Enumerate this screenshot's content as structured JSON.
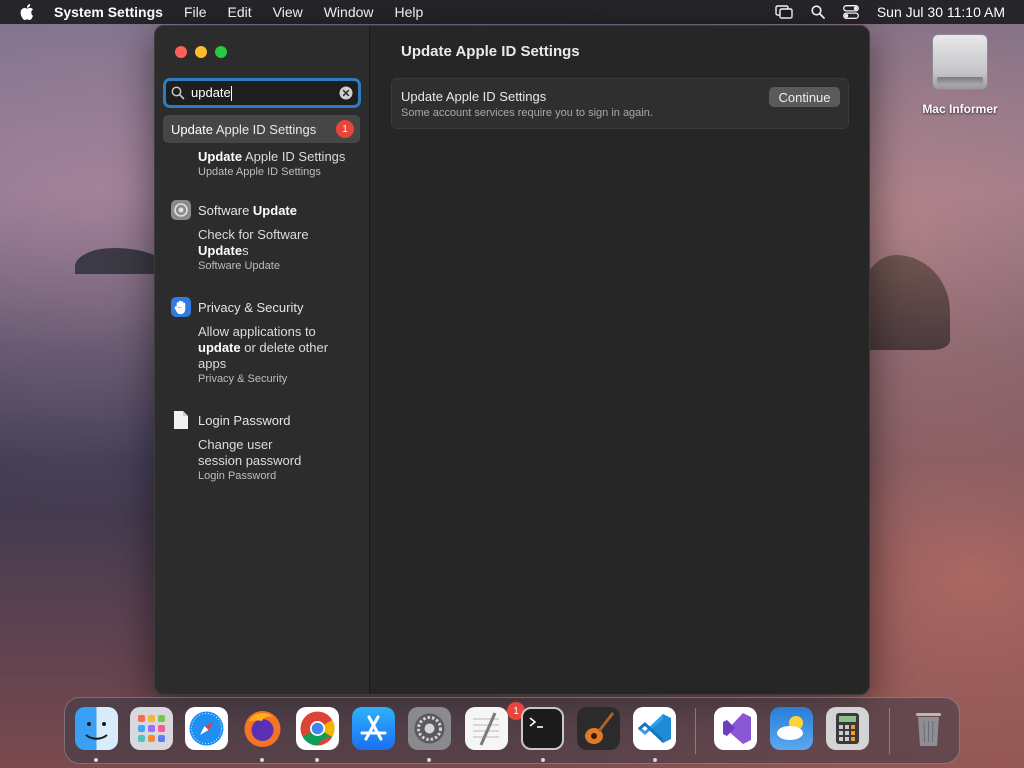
{
  "menubar": {
    "app_name": "System Settings",
    "items": [
      "File",
      "Edit",
      "View",
      "Window",
      "Help"
    ],
    "clock": "Sun Jul 30  11:10 AM"
  },
  "desktop": {
    "drive_label": "Mac Informer"
  },
  "window": {
    "search": {
      "value": "update",
      "placeholder": "Search"
    },
    "top_result": {
      "highlight": "Update",
      "rest": " Apple ID Settings",
      "badge": "1"
    },
    "groups": [
      {
        "icon": "apple-id-icon",
        "sub": {
          "bold": "Update",
          "rest": " Apple ID Settings",
          "category": "Update Apple ID Settings"
        }
      },
      {
        "title_plain": "Software ",
        "title_bold": "Update",
        "icon": "gear-icon",
        "sub": {
          "line1": "Check for Software",
          "bold": "Update",
          "rest": "s",
          "category": "Software Update"
        }
      },
      {
        "title_plain": "Privacy & Security",
        "icon": "hand-icon",
        "sub": {
          "line1": "Allow applications to",
          "bold": "update",
          "rest": " or delete other",
          "line3": "apps",
          "category": "Privacy & Security"
        }
      },
      {
        "title_plain": "Login Password",
        "icon": "document-icon",
        "sub": {
          "line1": "Change user",
          "line2": "session password",
          "category": "Login Password"
        }
      }
    ],
    "main": {
      "title": "Update Apple ID Settings",
      "panel_title": "Update Apple ID Settings",
      "panel_subtitle": "Some account services require you to sign in again.",
      "button": "Continue"
    }
  },
  "dock": {
    "apps": [
      "Finder",
      "Launchpad",
      "Safari",
      "Firefox",
      "Chrome",
      "App Store",
      "System Settings",
      "TextEdit",
      "Terminal",
      "GarageBand",
      "Visual Studio Code",
      "Visual Studio",
      "Weather",
      "Calculator",
      "Trash"
    ],
    "settings_badge": "1"
  },
  "colors": {
    "accent": "#2e7bc0",
    "badge": "#e8453c",
    "window_bg": "#262626",
    "sidebar_bg": "#2c2c2c"
  }
}
